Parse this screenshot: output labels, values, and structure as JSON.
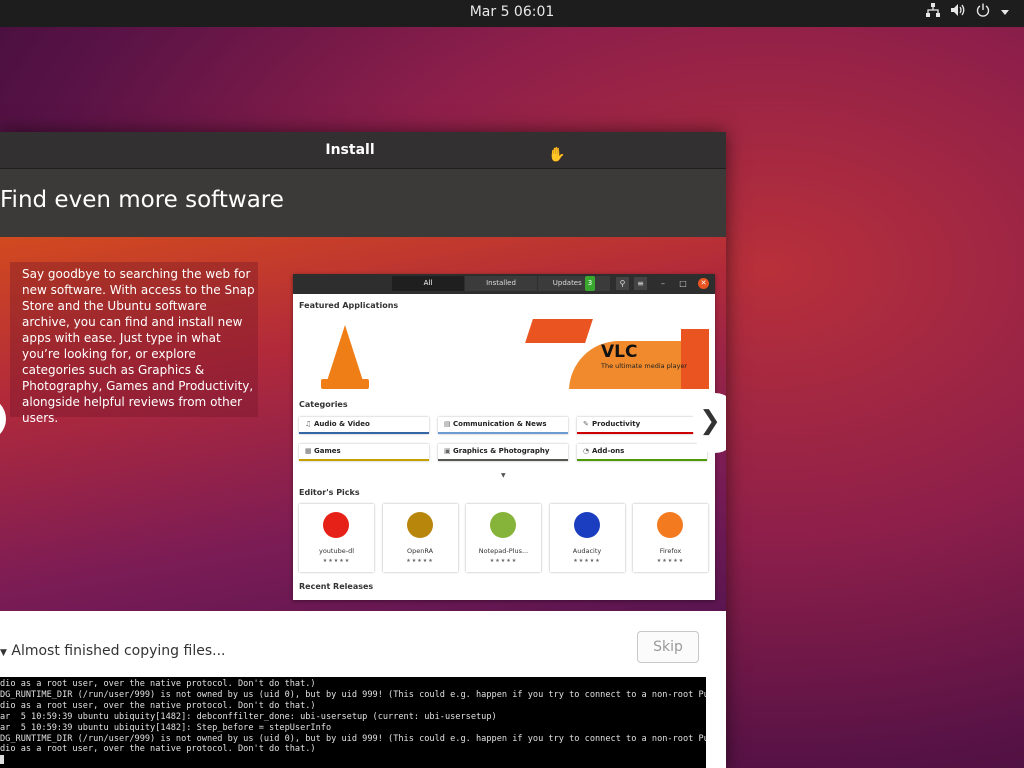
{
  "topbar": {
    "clock": "Mar 5  06:01",
    "icons": [
      "network-icon",
      "volume-icon",
      "power-icon",
      "menu-arrow-icon"
    ]
  },
  "window": {
    "title": "Install",
    "heading": "Find even more software",
    "slide_text": "Say goodbye to searching the web for new software. With access to the Snap Store and the Ubuntu software archive, you can find and install new apps with ease. Just type in what you’re looking for, or explore categories such as Graphics & Photography, Games and Productivity, alongside helpful reviews from other users.",
    "store": {
      "tabs": [
        "All",
        "Installed",
        "Updates"
      ],
      "updates_badge": "3",
      "featured_label": "Featured Applications",
      "banner_title": "VLC",
      "banner_subtitle": "The ultimate media player",
      "categories_label": "Categories",
      "categories": [
        {
          "label": "Audio & Video",
          "icon": "music-note-icon",
          "color": "#3465a4"
        },
        {
          "label": "Communication & News",
          "icon": "chat-icon",
          "color": "#6a9bd1"
        },
        {
          "label": "Productivity",
          "icon": "pencil-icon",
          "color": "#cc0000"
        },
        {
          "label": "Games",
          "icon": "games-icon",
          "color": "#c4a000"
        },
        {
          "label": "Graphics & Photography",
          "icon": "image-icon",
          "color": "#555753"
        },
        {
          "label": "Add-ons",
          "icon": "addon-icon",
          "color": "#4e9a06"
        }
      ],
      "picks_label": "Editor's Picks",
      "picks": [
        {
          "name": "youtube-dl",
          "stars": "★★★★★",
          "color": "#e62117"
        },
        {
          "name": "OpenRA",
          "stars": "★★★★★",
          "color": "#b8860b"
        },
        {
          "name": "Notepad-Plus...",
          "stars": "★★★★★",
          "color": "#86b33a"
        },
        {
          "name": "Audacity",
          "stars": "★★★★★",
          "color": "#1a3ebf"
        },
        {
          "name": "Firefox",
          "stars": "★★★★★",
          "color": "#f47a20"
        }
      ],
      "recent_label": "Recent Releases"
    },
    "next_glyph": "❯",
    "progress_label": "Almost finished copying files...",
    "skip_label": "Skip",
    "terminal": "dio as a root user, over the native protocol. Don't do that.)\nDG_RUNTIME_DIR (/run/user/999) is not owned by us (uid 0), but by uid 999! (This could e.g. happen if you try to connect to a non-root PulseA\ndio as a root user, over the native protocol. Don't do that.)\nar  5 10:59:39 ubuntu ubiquity[1482]: debconffilter_done: ubi-usersetup (current: ubi-usersetup)\nar  5 10:59:39 ubuntu ubiquity[1482]: Step_before = stepUserInfo\nDG_RUNTIME_DIR (/run/user/999) is not owned by us (uid 0), but by uid 999! (This could e.g. happen if you try to connect to a non-root PulseA\ndio as a root user, over the native protocol. Don't do that.)"
  }
}
